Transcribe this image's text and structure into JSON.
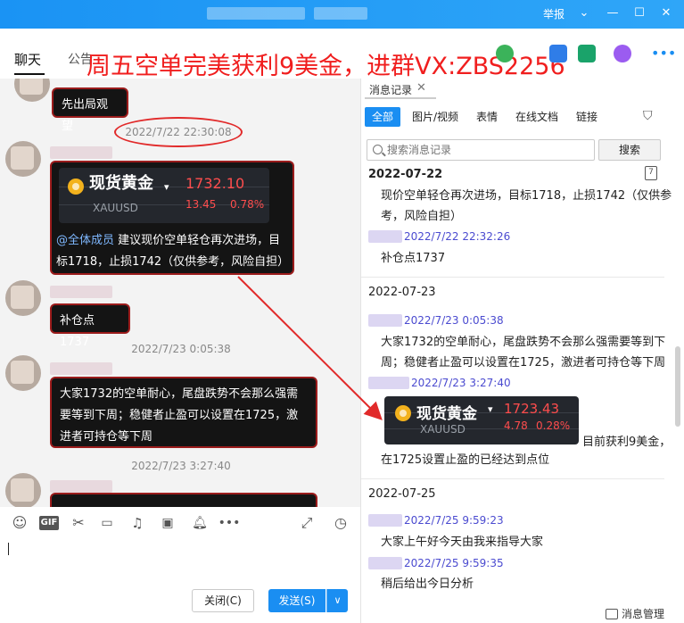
{
  "titlebar": {
    "report_label": "举报",
    "chevron": "chevron-down-icon",
    "minimize": "minimize-icon",
    "maximize": "maximize-icon",
    "close": "close-icon",
    "accent": "#1a93f4"
  },
  "tabs": {
    "chat_label": "聊天",
    "announce_label": "公告"
  },
  "overlay_banner": "周五空单完美获利9美金，进群VX:ZBS2256",
  "chat": {
    "messages": [
      {
        "text": "先出局观望"
      },
      {
        "timestamp": "2022/7/22 22:30:08"
      },
      {
        "card": {
          "name": "现货黄金",
          "code": "XAUUSD",
          "price": "1732.10",
          "change": "13.45",
          "percent": "0.78%"
        },
        "mention": "@全体成员",
        "text": " 建议现价空单轻仓再次进场，目标1718，止损1742（仅供参考，风险自担）"
      },
      {
        "text": "补仓点1737"
      },
      {
        "timestamp": "2022/7/23 0:05:38"
      },
      {
        "text": "大家1732的空单耐心，尾盘跌势不会那么强需要等到下周；稳健者止盈可以设置在1725，激进者可持仓等下周"
      },
      {
        "timestamp": "2022/7/23 3:27:40"
      }
    ]
  },
  "composer": {
    "tools": [
      "emoji-icon",
      "gif-icon",
      "scissors-icon",
      "folder-icon",
      "music-icon",
      "image-icon",
      "bell-icon",
      "more-icon",
      "expand-icon",
      "history-icon"
    ],
    "gif_label": "GIF",
    "more_label": "•••",
    "close_label": "关闭(C)",
    "send_label": "发送(S)",
    "send_more": "∨"
  },
  "history": {
    "tab_label": "消息记录",
    "filters": [
      "全部",
      "图片/视频",
      "表情",
      "在线文档",
      "链接"
    ],
    "search_placeholder": "搜索消息记录",
    "search_button": "搜索",
    "calendar_day": "7",
    "groups": [
      {
        "date": "2022-07-22",
        "items": [
          {
            "text": "现价空单轻仓再次进场，目标1718，止损1742（仅供参考，风险自担）"
          },
          {
            "timestamp": "2022/7/22 22:32:26",
            "text": "补仓点1737"
          }
        ]
      },
      {
        "date": "2022-07-23",
        "items": [
          {
            "timestamp": "2022/7/23 0:05:38",
            "text": "大家1732的空单耐心，尾盘跌势不会那么强需要等到下周；稳健者止盈可以设置在1725，激进者可持仓等下周"
          },
          {
            "timestamp": "2022/7/23 3:27:40",
            "card": {
              "name": "现货黄金",
              "code": "XAUUSD",
              "price": "1723.43",
              "change": "4.78",
              "percent": "0.28%"
            },
            "text_tail": "目前获利9美金，",
            "text": "在1725设置止盈的已经达到点位"
          }
        ]
      },
      {
        "date": "2022-07-25",
        "items": [
          {
            "timestamp": "2022/7/25 9:59:23",
            "text": "大家上午好今天由我来指导大家"
          },
          {
            "timestamp": "2022/7/25 9:59:35",
            "text": "稍后给出今日分析"
          }
        ]
      }
    ],
    "manage_label": "消息管理"
  },
  "colors": {
    "annotation_red": "#e12a2a",
    "send_blue": "#1a8ef2",
    "price_red": "#ff4d4d",
    "history_ts": "#4b4bd0"
  }
}
